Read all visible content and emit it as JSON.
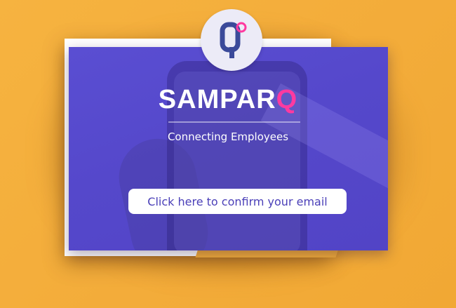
{
  "brand": {
    "name_main": "SAMPAR",
    "name_accent": "Q",
    "logo_letter": "Q",
    "tagline": "Connecting Employees"
  },
  "cta": {
    "label": "Click here to confirm your email"
  },
  "colors": {
    "background": "#f3ac3a",
    "card": "#5548cb",
    "accent": "#ff3aa0",
    "logo_q": "#3b4a9a",
    "button_text": "#4a3fb8"
  },
  "icons": {
    "logo": "samparq-q-logo-icon"
  }
}
